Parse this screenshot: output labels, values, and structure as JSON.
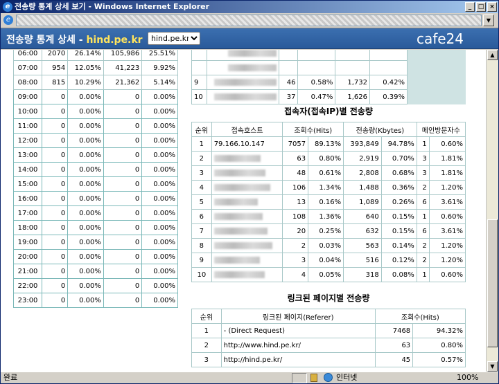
{
  "window": {
    "title": "전송량 통계 상세 보기 - Windows Internet Explorer",
    "min": "_",
    "max": "□",
    "close": "×"
  },
  "header": {
    "title_prefix": "전송량 통계 상세 - ",
    "site": "hind.pe.kr",
    "select_value": "hind.pe.kr",
    "logo": "cafe24"
  },
  "hourly": [
    [
      "06:00",
      "2070",
      "26.14%",
      "105,986",
      "25.51%"
    ],
    [
      "07:00",
      "954",
      "12.05%",
      "41,223",
      "9.92%"
    ],
    [
      "08:00",
      "815",
      "10.29%",
      "21,362",
      "5.14%"
    ],
    [
      "09:00",
      "0",
      "0.00%",
      "0",
      "0.00%"
    ],
    [
      "10:00",
      "0",
      "0.00%",
      "0",
      "0.00%"
    ],
    [
      "11:00",
      "0",
      "0.00%",
      "0",
      "0.00%"
    ],
    [
      "12:00",
      "0",
      "0.00%",
      "0",
      "0.00%"
    ],
    [
      "13:00",
      "0",
      "0.00%",
      "0",
      "0.00%"
    ],
    [
      "14:00",
      "0",
      "0.00%",
      "0",
      "0.00%"
    ],
    [
      "15:00",
      "0",
      "0.00%",
      "0",
      "0.00%"
    ],
    [
      "16:00",
      "0",
      "0.00%",
      "0",
      "0.00%"
    ],
    [
      "17:00",
      "0",
      "0.00%",
      "0",
      "0.00%"
    ],
    [
      "18:00",
      "0",
      "0.00%",
      "0",
      "0.00%"
    ],
    [
      "19:00",
      "0",
      "0.00%",
      "0",
      "0.00%"
    ],
    [
      "20:00",
      "0",
      "0.00%",
      "0",
      "0.00%"
    ],
    [
      "21:00",
      "0",
      "0.00%",
      "0",
      "0.00%"
    ],
    [
      "22:00",
      "0",
      "0.00%",
      "0",
      "0.00%"
    ],
    [
      "23:00",
      "0",
      "0.00%",
      "0",
      "0.00%"
    ]
  ],
  "top_fragment": [
    [
      "",
      "",
      "",
      "",
      ""
    ],
    [
      "",
      "",
      "",
      "",
      ""
    ],
    [
      "9",
      "46",
      "0.58%",
      "1,732",
      "0.42%"
    ],
    [
      "10",
      "37",
      "0.47%",
      "1,626",
      "0.39%"
    ]
  ],
  "hosts_section": {
    "title": "접속자(접속IP)별 전송량",
    "headers": [
      "순위",
      "접속호스트",
      "조회수(Hits)",
      "전송량(Kbytes)",
      "메인방문자수"
    ],
    "rows": [
      [
        "1",
        "79.166.10.147",
        "7057",
        "89.13%",
        "393,849",
        "94.78%",
        "1",
        "0.60%"
      ],
      [
        "2",
        "",
        "63",
        "0.80%",
        "2,919",
        "0.70%",
        "3",
        "1.81%"
      ],
      [
        "3",
        "",
        "48",
        "0.61%",
        "2,808",
        "0.68%",
        "3",
        "1.81%"
      ],
      [
        "4",
        "",
        "106",
        "1.34%",
        "1,488",
        "0.36%",
        "2",
        "1.20%"
      ],
      [
        "5",
        "",
        "13",
        "0.16%",
        "1,089",
        "0.26%",
        "6",
        "3.61%"
      ],
      [
        "6",
        "",
        "108",
        "1.36%",
        "640",
        "0.15%",
        "1",
        "0.60%"
      ],
      [
        "7",
        "",
        "20",
        "0.25%",
        "632",
        "0.15%",
        "6",
        "3.61%"
      ],
      [
        "8",
        "",
        "2",
        "0.03%",
        "563",
        "0.14%",
        "2",
        "1.20%"
      ],
      [
        "9",
        "",
        "3",
        "0.04%",
        "516",
        "0.12%",
        "2",
        "1.20%"
      ],
      [
        "10",
        "",
        "4",
        "0.05%",
        "318",
        "0.08%",
        "1",
        "0.60%"
      ]
    ]
  },
  "refs_section": {
    "title": "링크된 페이지별 전송량",
    "headers": [
      "순위",
      "링크된 페이지(Referer)",
      "조회수(Hits)"
    ],
    "rows": [
      [
        "1",
        "- (Direct Request)",
        "7468",
        "94.32%"
      ],
      [
        "2",
        "http://www.hind.pe.kr/",
        "63",
        "0.80%"
      ],
      [
        "3",
        "http://hind.pe.kr/",
        "45",
        "0.57%"
      ]
    ]
  },
  "status": {
    "text": "완료",
    "zone": "인터넷",
    "zoom": "100%"
  }
}
